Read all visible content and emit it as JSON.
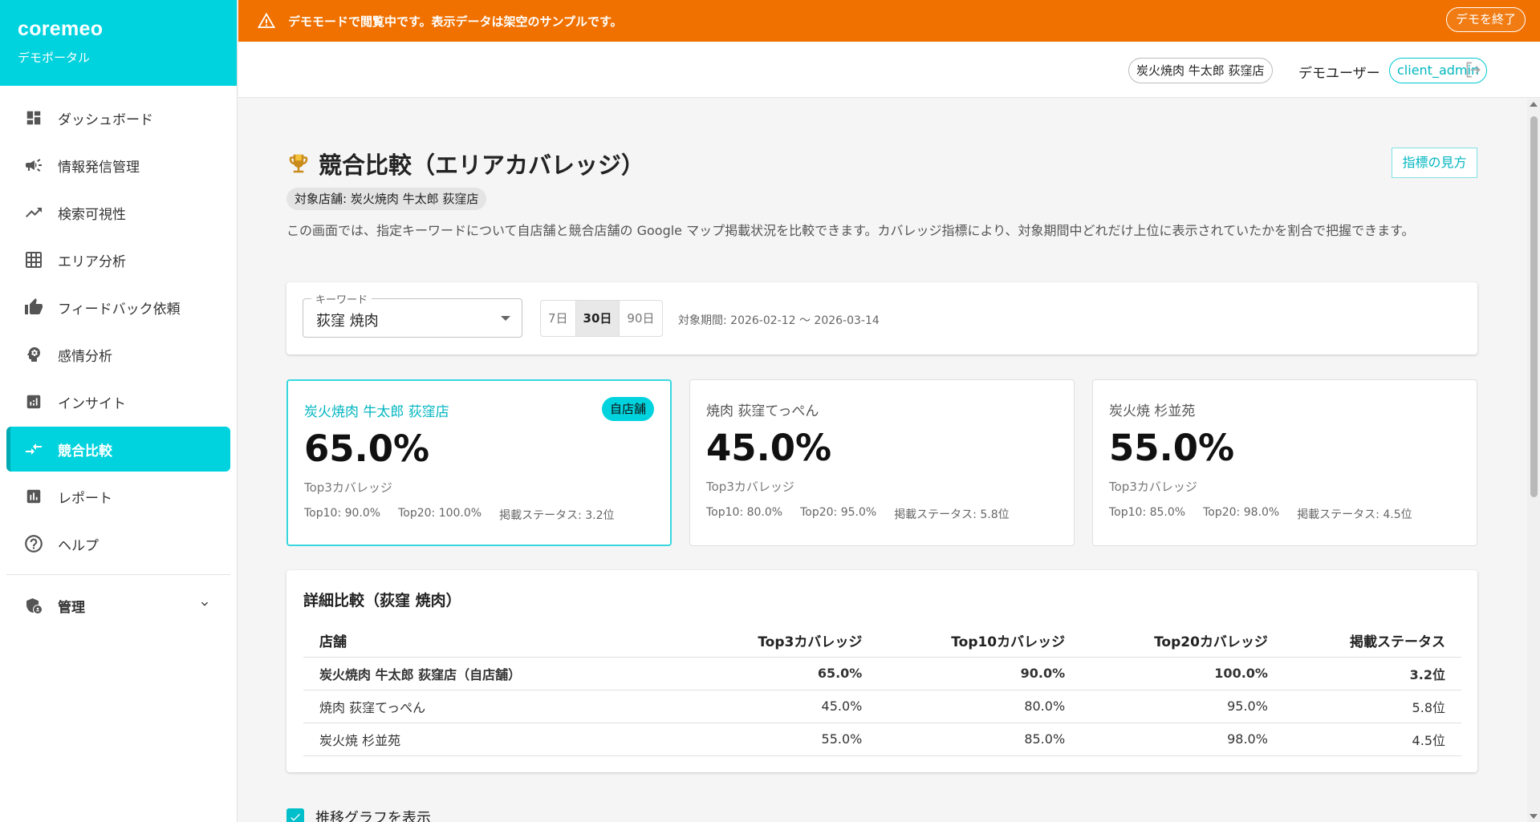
{
  "app": {
    "logo": "coremeo",
    "subtitle": "デモポータル"
  },
  "sidebar": {
    "items": [
      {
        "label": "ダッシュボード",
        "icon": "dashboard-icon"
      },
      {
        "label": "情報発信管理",
        "icon": "megaphone-icon"
      },
      {
        "label": "検索可視性",
        "icon": "trending-up-icon"
      },
      {
        "label": "エリア分析",
        "icon": "grid-icon"
      },
      {
        "label": "フィードバック依頼",
        "icon": "thumb-up-icon"
      },
      {
        "label": "感情分析",
        "icon": "psychology-icon"
      },
      {
        "label": "インサイト",
        "icon": "insights-icon"
      },
      {
        "label": "競合比較",
        "icon": "compare-arrows-icon",
        "active": true
      },
      {
        "label": "レポート",
        "icon": "bar-chart-icon"
      },
      {
        "label": "ヘルプ",
        "icon": "help-icon"
      }
    ],
    "admin": {
      "label": "管理",
      "icon": "admin-shield-icon"
    }
  },
  "banner": {
    "message": "デモモードで閲覧中です。表示データは架空のサンプルです。",
    "end_button": "デモを終了"
  },
  "header": {
    "store": "炭火焼肉 牛太郎 荻窪店",
    "user": "デモユーザー",
    "role": "client_admin"
  },
  "page": {
    "title": "競合比較（エリアカバレッジ）",
    "guide_button": "指標の見方",
    "target_store": "対象店舗: 炭火焼肉 牛太郎 荻窪店",
    "description": "この画面では、指定キーワードについて自店舗と競合店舗の Google マップ掲載状況を比較できます。カバレッジ指標により、対象期間中どれだけ上位に表示されていたかを割合で把握できます。"
  },
  "filters": {
    "keyword_label": "キーワード",
    "keyword_value": "荻窪 焼肉",
    "ranges": [
      "7日",
      "30日",
      "90日"
    ],
    "selected_range": "30日",
    "period": "対象期間: 2026-02-12 〜 2026-03-14"
  },
  "cards": [
    {
      "name": "炭火焼肉 牛太郎 荻窪店",
      "badge": "自店舗",
      "top3": "65.0%",
      "label": "Top3カバレッジ",
      "top10": "Top10: 90.0%",
      "top20": "Top20: 100.0%",
      "status": "掲載ステータス: 3.2位"
    },
    {
      "name": "焼肉 荻窪てっぺん",
      "top3": "45.0%",
      "label": "Top3カバレッジ",
      "top10": "Top10: 80.0%",
      "top20": "Top20: 95.0%",
      "status": "掲載ステータス: 5.8位"
    },
    {
      "name": "炭火焼 杉並苑",
      "top3": "55.0%",
      "label": "Top3カバレッジ",
      "top10": "Top10: 85.0%",
      "top20": "Top20: 98.0%",
      "status": "掲載ステータス: 4.5位"
    }
  ],
  "detail": {
    "title": "詳細比較（荻窪 焼肉）",
    "columns": [
      "店舗",
      "Top3カバレッジ",
      "Top10カバレッジ",
      "Top20カバレッジ",
      "掲載ステータス"
    ],
    "rows": [
      [
        "炭火焼肉 牛太郎 荻窪店（自店舗）",
        "65.0%",
        "90.0%",
        "100.0%",
        "3.2位"
      ],
      [
        "焼肉 荻窪てっぺん",
        "45.0%",
        "80.0%",
        "95.0%",
        "5.8位"
      ],
      [
        "炭火焼 杉並苑",
        "55.0%",
        "85.0%",
        "98.0%",
        "4.5位"
      ]
    ]
  },
  "trend_toggle": {
    "label": "推移グラフを表示",
    "checked": true
  },
  "colors": {
    "brand": "#00d3de",
    "banner": "#f07100",
    "accent_text": "#00b6c0"
  }
}
